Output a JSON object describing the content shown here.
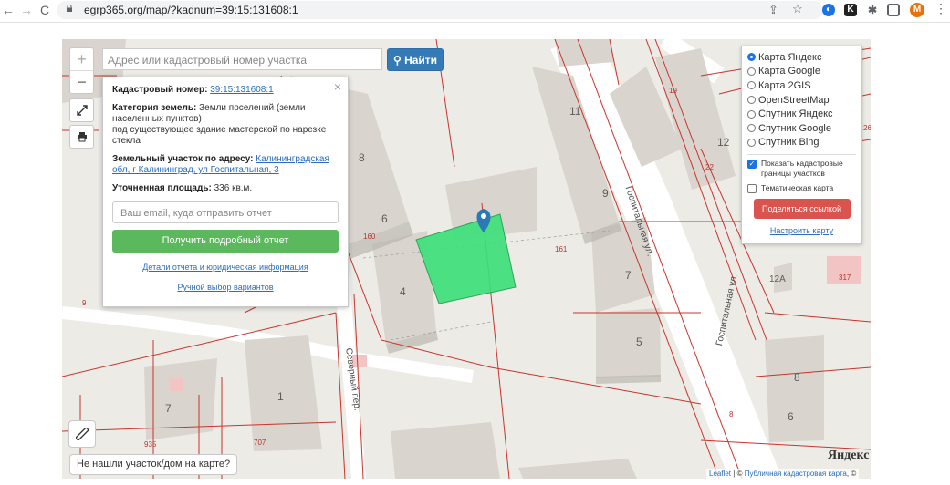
{
  "browser": {
    "back": "←",
    "forward": "→",
    "reload": "C",
    "url": "egrp365.org/map/?kadnum=39:15:131608:1",
    "profile_initial": "M"
  },
  "map": {
    "zoom_in": "+",
    "zoom_out": "−",
    "search_placeholder": "Адрес или кадастровый номер участка",
    "find_button": "Найти",
    "house_numbers": [
      "11",
      "12",
      "9",
      "8",
      "6",
      "4",
      "7",
      "5",
      "1",
      "7",
      "8",
      "6",
      "12А"
    ],
    "parcel_numbers": [
      "19",
      "26",
      "22",
      "160",
      "161",
      "9",
      "707",
      "935",
      "8",
      "317"
    ],
    "streets": [
      "Госпитальная ул.",
      "Северный пер.",
      "Госпитальная ул."
    ],
    "parcel_color": "#3ee07a",
    "marker_color": "#2a7ab8"
  },
  "popup": {
    "close": "×",
    "cadastral_label": "Кадастровый номер:",
    "cadastral_value": "39:15:131608:1",
    "category_label": "Категория земель:",
    "category_value": "Земли поселений (земли населенных пунктов)",
    "purpose": "под существующее здание мастерской по нарезке стекла",
    "address_label": "Земельный участок по адресу:",
    "address_value": "Калининградская обл, г Калининград, ул Госпитальная, 3",
    "area_label": "Уточненная площадь:",
    "area_value": "336 кв.м.",
    "email_placeholder": "Ваш email, куда отправить отчет",
    "report_button": "Получить подробный отчет",
    "details_link": "Детали отчета и юридическая информация",
    "manual_link": "Ручной выбор вариантов"
  },
  "layers": {
    "options": [
      {
        "label": "Карта Яндекс",
        "selected": true
      },
      {
        "label": "Карта Google",
        "selected": false
      },
      {
        "label": "Карта 2GIS",
        "selected": false
      },
      {
        "label": "OpenStreetMap",
        "selected": false
      },
      {
        "label": "Спутник Яндекс",
        "selected": false
      },
      {
        "label": "Спутник Google",
        "selected": false
      },
      {
        "label": "Спутник Bing",
        "selected": false
      }
    ],
    "show_borders": "Показать кадастровые границы участков",
    "thematic": "Тематическая карта",
    "share_button": "Поделиться ссылкой",
    "setup_link": "Настроить карту"
  },
  "bottom": {
    "not_found": "Не нашли участок/дом на карте?",
    "yandex_logo": "Яндекс",
    "attribution_leaflet": "Leaflet",
    "attribution_sep": "| ©",
    "attribution_pkk": "Публичная кадастровая карта",
    "attribution_tail": ", ©"
  }
}
